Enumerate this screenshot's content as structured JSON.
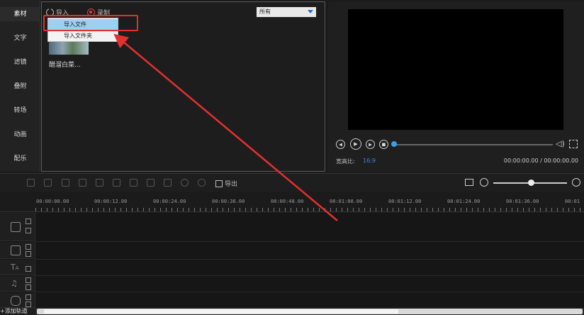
{
  "sidebar": {
    "items": [
      {
        "label": "素材"
      },
      {
        "label": "文字"
      },
      {
        "label": "滤镜"
      },
      {
        "label": "叠附"
      },
      {
        "label": "转场"
      },
      {
        "label": "动画"
      },
      {
        "label": "配乐"
      }
    ]
  },
  "media_panel": {
    "import_label": "导入",
    "record_label": "录制",
    "filter_select": "所有",
    "thumbnail_label": "醋溜白菜..."
  },
  "import_menu": {
    "items": [
      {
        "label": "导入文件",
        "highlighted": true
      },
      {
        "label": "导入文件夹",
        "highlighted": false
      }
    ]
  },
  "preview": {
    "aspect_label": "宽高比:",
    "aspect_value": "16:9",
    "time": "00:00:00.00 / 00:00:00.00"
  },
  "timeline": {
    "export_label": "导出",
    "ruler_ticks": [
      "00:00:00.00",
      "00:00:12.00",
      "00:00:24.00",
      "00:00:36.00",
      "00:00:48.00",
      "00:01:00.00",
      "00:01:12.00",
      "00:01:24.00",
      "00:01:36.00",
      "00:01"
    ],
    "add_track_label": "+添加轨道"
  },
  "colors": {
    "accent": "#3a9ee8",
    "annotation": "#e23030",
    "menu_highlight": "#9cd0f0"
  }
}
